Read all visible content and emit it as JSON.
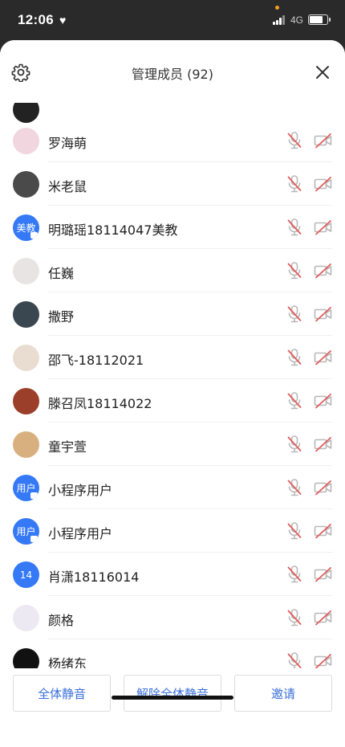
{
  "status_bar": {
    "time": "12:06",
    "network": "4G"
  },
  "header": {
    "title": "管理成员 (92)",
    "settings_icon": "gear-icon",
    "close_icon": "close-icon"
  },
  "members": [
    {
      "name": "罗海萌",
      "avatar_text": "",
      "avatar_color": "#f2d6df",
      "mic": "muted",
      "camera": "off"
    },
    {
      "name": "米老鼠",
      "avatar_text": "",
      "avatar_color": "#4a4a4a",
      "mic": "muted",
      "camera": "off"
    },
    {
      "name": "明璐瑶18114047美教",
      "avatar_text": "美教",
      "avatar_color": "#3579f6",
      "mic": "muted",
      "camera": "off"
    },
    {
      "name": "任巍",
      "avatar_text": "",
      "avatar_color": "#e9e4e4",
      "mic": "muted",
      "camera": "off"
    },
    {
      "name": "撒野",
      "avatar_text": "",
      "avatar_color": "#3b4750",
      "mic": "muted",
      "camera": "off"
    },
    {
      "name": "邵飞-18112021",
      "avatar_text": "",
      "avatar_color": "#e8ddd0",
      "mic": "muted",
      "camera": "off"
    },
    {
      "name": "滕召凤18114022",
      "avatar_text": "",
      "avatar_color": "#9b3f2a",
      "mic": "muted",
      "camera": "off"
    },
    {
      "name": "童宇萱",
      "avatar_text": "",
      "avatar_color": "#d8b080",
      "mic": "muted",
      "camera": "off"
    },
    {
      "name": "小程序用户",
      "avatar_text": "用户",
      "avatar_color": "#3579f6",
      "mic": "muted",
      "camera": "off"
    },
    {
      "name": "小程序用户",
      "avatar_text": "用户",
      "avatar_color": "#3579f6",
      "mic": "muted",
      "camera": "off"
    },
    {
      "name": "肖潇18116014",
      "avatar_text": "14",
      "avatar_color": "#3579f6",
      "mic": "muted",
      "camera": "off"
    },
    {
      "name": "颜格",
      "avatar_text": "",
      "avatar_color": "#ece9f3",
      "mic": "muted",
      "camera": "off"
    },
    {
      "name": "杨绪东",
      "avatar_text": "",
      "avatar_color": "#111111",
      "mic": "muted",
      "camera": "off"
    }
  ],
  "footer": {
    "mute_all": "全体静音",
    "unmute_all": "解除全体静音",
    "invite": "邀请"
  },
  "colors": {
    "accent": "#3579f6",
    "muted_red": "#e35a5a",
    "button_text": "#3a6fd8"
  }
}
